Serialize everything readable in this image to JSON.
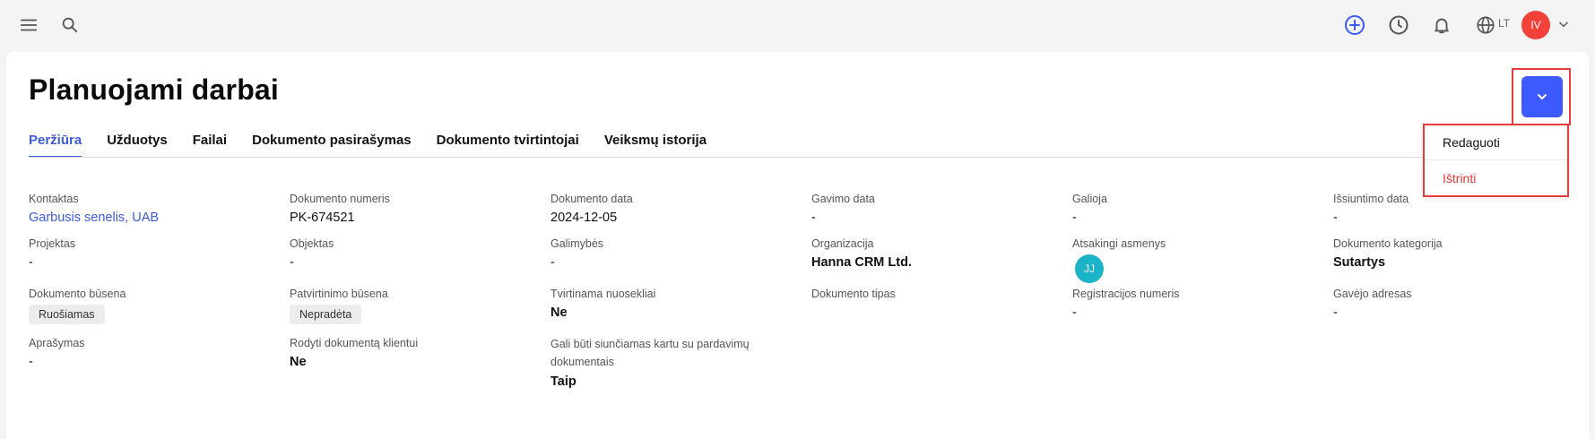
{
  "topbar": {
    "language": "LT",
    "user_initials": "IV"
  },
  "page": {
    "title": "Planuojami darbai"
  },
  "tabs": [
    {
      "label": "Peržiūra",
      "active": true
    },
    {
      "label": "Užduotys",
      "active": false
    },
    {
      "label": "Failai",
      "active": false
    },
    {
      "label": "Dokumento pasirašymas",
      "active": false
    },
    {
      "label": "Dokumento tvirtintojai",
      "active": false
    },
    {
      "label": "Veiksmų istorija",
      "active": false
    }
  ],
  "dropdown": {
    "edit": "Redaguoti",
    "delete": "Ištrinti"
  },
  "fields": {
    "kontaktas": {
      "label": "Kontaktas",
      "value": "Garbusis senelis, UAB"
    },
    "dokumento_numeris": {
      "label": "Dokumento numeris",
      "value": "PK-674521"
    },
    "dokumento_data": {
      "label": "Dokumento data",
      "value": "2024-12-05"
    },
    "gavimo_data": {
      "label": "Gavimo data",
      "value": "-"
    },
    "galioja": {
      "label": "Galioja",
      "value": "-"
    },
    "issiuntimo_data": {
      "label": "Išsiuntimo data",
      "value": "-"
    },
    "projektas": {
      "label": "Projektas",
      "value": "-"
    },
    "objektas": {
      "label": "Objektas",
      "value": "-"
    },
    "galimybes": {
      "label": "Galimybės",
      "value": "-"
    },
    "organizacija": {
      "label": "Organizacija",
      "value": "Hanna CRM Ltd."
    },
    "atsakingi_asmenys": {
      "label": "Atsakingi asmenys",
      "value": "JJ"
    },
    "dokumento_kategorija": {
      "label": "Dokumento kategorija",
      "value": "Sutartys"
    },
    "dokumento_busena": {
      "label": "Dokumento būsena",
      "value": "Ruošiamas"
    },
    "patvirtinimo_busena": {
      "label": "Patvirtinimo būsena",
      "value": "Nepradėta"
    },
    "tvirtinama_nuosekliai": {
      "label": "Tvirtinama nuosekliai",
      "value": "Ne"
    },
    "dokumento_tipas": {
      "label": "Dokumento tipas",
      "value": ""
    },
    "registracijos_numeris": {
      "label": "Registracijos numeris",
      "value": "-"
    },
    "gavejo_adresas": {
      "label": "Gavėjo adresas",
      "value": "-"
    },
    "aprasymas": {
      "label": "Aprašymas",
      "value": "-"
    },
    "rodyti_klientui": {
      "label": "Rodyti dokumentą klientui",
      "value": "Ne"
    },
    "siunciamas_kartu": {
      "label": "Gali būti siunčiamas kartu su pardavimų dokumentais",
      "value": "Taip"
    }
  },
  "colors": {
    "accent": "#3b5bdb",
    "primary_button": "#3d5afe",
    "danger": "#e53935",
    "avatar": "#f2403a",
    "assignee_avatar": "#1ab3c8"
  }
}
